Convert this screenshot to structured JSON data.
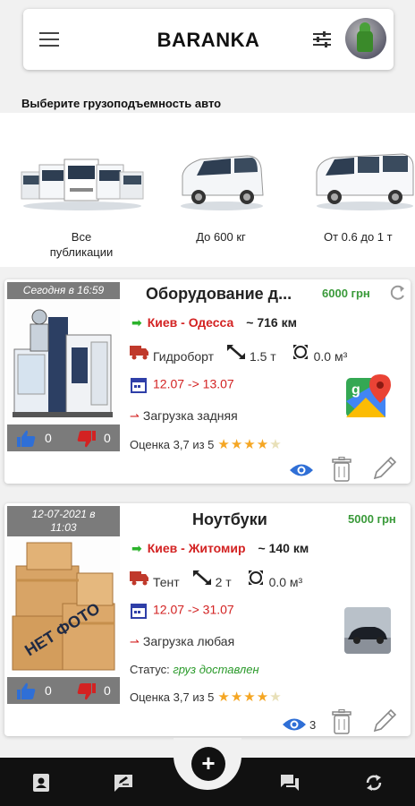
{
  "app": {
    "title": "BARANKA"
  },
  "header": {
    "menu_icon": "menu-icon",
    "filter_icon": "tune-icon",
    "avatar": "user-avatar"
  },
  "categories_section": {
    "title": "Выберите грузоподъемность авто",
    "items": [
      {
        "label_line1": "Все",
        "label_line2": "публикации",
        "icon": "truck-fleet-image"
      },
      {
        "label_line1": "До 600 кг",
        "label_line2": "",
        "icon": "small-van-image"
      },
      {
        "label_line1": "От 0.6 до 1 т",
        "label_line2": "",
        "icon": "van-image"
      }
    ]
  },
  "listings": [
    {
      "date_line1": "Сегодня в 16:59",
      "date_line2": "",
      "photo": "packaging-machine-photo",
      "likes": "0",
      "dislikes": "0",
      "title": "Оборудование д...",
      "price": "6000 грн",
      "route": "Киев - Одесса",
      "distance": "~ 716 км",
      "body_type": "Гидроборт",
      "weight": "1.5 т",
      "volume": "0.0 м³",
      "dates": "12.07 -> 13.07",
      "loading": "Загрузка задняя",
      "rating_text": "Оценка 3,7 из 5",
      "rating_value": 3.7,
      "views": ""
    },
    {
      "date_line1": "12-07-2021 в",
      "date_line2": "11:03",
      "photo": "no-photo-boxes-image",
      "no_photo_text": "НЕТ ФОТО",
      "likes": "0",
      "dislikes": "0",
      "title": "Ноутбуки",
      "price": "5000 грн",
      "route": "Киев - Житомир",
      "distance": "~ 140 км",
      "body_type": "Тент",
      "weight": "2 т",
      "volume": "0.0 м³",
      "dates": "12.07 -> 31.07",
      "loading": "Загрузка любая",
      "status_label": "Статус:",
      "status_value": "груз доставлен",
      "rating_text": "Оценка 3,7 из 5",
      "rating_value": 3.7,
      "views": "3"
    }
  ],
  "colors": {
    "accent_red": "#d32222",
    "accent_green": "#3a9a3a",
    "route_arrow": "#2bb32b",
    "badge_gray": "#7b7b7b",
    "like_blue": "#2f6fd6",
    "dislike_red": "#d32222",
    "star": "#f5a623",
    "eye_blue": "#2f6fd6"
  },
  "bottom_nav": {
    "items": [
      "contacts-icon",
      "messages-edit-icon",
      "add-icon",
      "chat-icon",
      "sync-icon"
    ]
  }
}
